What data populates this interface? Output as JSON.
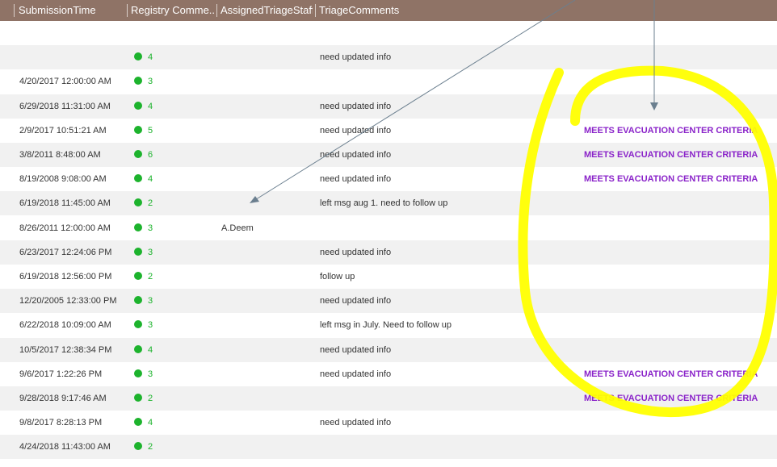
{
  "columns": [
    "SubmissionTime",
    "Registry Comme...",
    "AssignedTriageStaff",
    "TriageComments"
  ],
  "colors": {
    "header_bg": "#8f7366",
    "status_dot": "#1db32d",
    "criteria_text": "#8a23c9",
    "annotation": "#ffff00",
    "arrow": "#6b7f8f"
  },
  "icons": {
    "status": "green-dot-icon"
  },
  "rows": [
    {
      "time": "",
      "score": "",
      "staff": "",
      "comment": "",
      "flag": ""
    },
    {
      "time": "",
      "score": "4",
      "staff": "",
      "comment": "need updated info",
      "flag": ""
    },
    {
      "time": "4/20/2017 12:00:00 AM",
      "score": "3",
      "staff": "",
      "comment": "",
      "flag": ""
    },
    {
      "time": "6/29/2018 11:31:00 AM",
      "score": "4",
      "staff": "",
      "comment": "need updated info",
      "flag": ""
    },
    {
      "time": "2/9/2017 10:51:21 AM",
      "score": "5",
      "staff": "",
      "comment": "need updated info",
      "flag": "MEETS EVACUATION CENTER CRITERIA"
    },
    {
      "time": "3/8/2011 8:48:00 AM",
      "score": "6",
      "staff": "",
      "comment": "need updated info",
      "flag": "MEETS EVACUATION CENTER CRITERIA"
    },
    {
      "time": "8/19/2008 9:08:00 AM",
      "score": "4",
      "staff": "",
      "comment": "need updated info",
      "flag": "MEETS EVACUATION CENTER CRITERIA"
    },
    {
      "time": "6/19/2018 11:45:00 AM",
      "score": "2",
      "staff": "",
      "comment": "left msg aug 1. need to follow up",
      "flag": ""
    },
    {
      "time": "8/26/2011 12:00:00 AM",
      "score": "3",
      "staff": "A.Deem",
      "comment": "",
      "flag": ""
    },
    {
      "time": "6/23/2017 12:24:06 PM",
      "score": "3",
      "staff": "",
      "comment": "need updated info",
      "flag": ""
    },
    {
      "time": "6/19/2018 12:56:00 PM",
      "score": "2",
      "staff": "",
      "comment": "follow up",
      "flag": ""
    },
    {
      "time": "12/20/2005 12:33:00 PM",
      "score": "3",
      "staff": "",
      "comment": "need updated info",
      "flag": ""
    },
    {
      "time": "6/22/2018 10:09:00 AM",
      "score": "3",
      "staff": "",
      "comment": "left msg in July. Need to follow up",
      "flag": ""
    },
    {
      "time": "10/5/2017 12:38:34 PM",
      "score": "4",
      "staff": "",
      "comment": "need updated info",
      "flag": ""
    },
    {
      "time": "9/6/2017 1:22:26 PM",
      "score": "3",
      "staff": "",
      "comment": "need updated info",
      "flag": "MEETS EVACUATION CENTER CRITERIA"
    },
    {
      "time": "9/28/2018 9:17:46 AM",
      "score": "2",
      "staff": "",
      "comment": "",
      "flag": "MEETS EVACUATION CENTER CRITERIA"
    },
    {
      "time": "9/8/2017 8:28:13 PM",
      "score": "4",
      "staff": "",
      "comment": "need updated info",
      "flag": ""
    },
    {
      "time": "4/24/2018 11:43:00 AM",
      "score": "2",
      "staff": "",
      "comment": "",
      "flag": ""
    }
  ]
}
